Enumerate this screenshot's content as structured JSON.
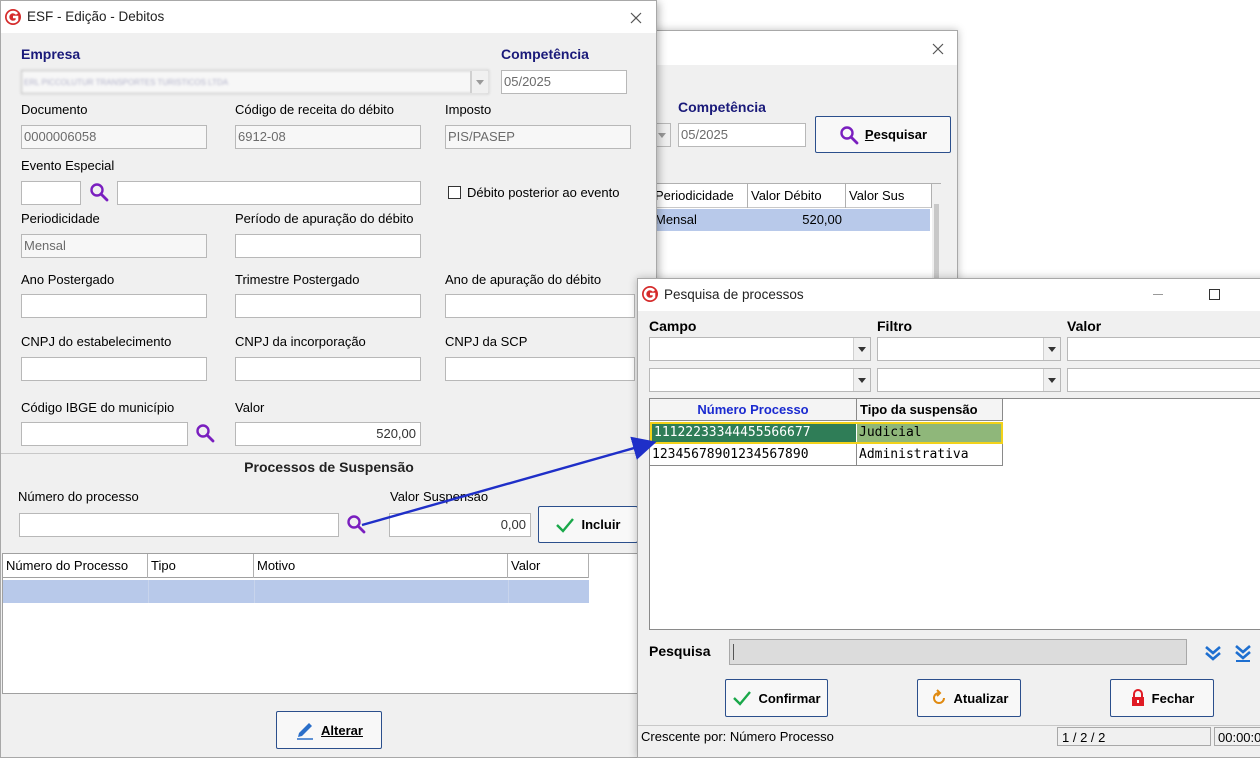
{
  "bg_window": {
    "competencia_label": "Competência",
    "competencia_value": "05/2025",
    "search_button": "Pesquisar",
    "grid_headers": [
      "Periodicidade",
      "Valor Débito",
      "Valor Sus"
    ],
    "grid_row": {
      "periodicidade": "Mensal",
      "valor": "520,00"
    }
  },
  "main_window": {
    "title": "ESF - Edição - Debitos",
    "empresa_label": "Empresa",
    "empresa_value": "ERL PICCOLUTUR TRANSPORTES TURISTICOS LTDA",
    "competencia_label": "Competência",
    "competencia_value": "05/2025",
    "documento_label": "Documento",
    "documento_value": "0000006058",
    "codigo_receita_label": "Código de receita do débito",
    "codigo_receita_value": "6912-08",
    "imposto_label": "Imposto",
    "imposto_value": "PIS/PASEP",
    "evento_especial_label": "Evento Especial",
    "debito_posterior_label": "Débito posterior ao evento",
    "periodicidade_label": "Periodicidade",
    "periodicidade_value": "Mensal",
    "periodo_apuracao_label": "Período de apuração do débito",
    "ano_postergado_label": "Ano Postergado",
    "trimestre_postergado_label": "Trimestre Postergado",
    "ano_apuracao_label": "Ano de apuração do débito",
    "cnpj_estab_label": "CNPJ do estabelecimento",
    "cnpj_incorp_label": "CNPJ da incorporação",
    "cnpj_scp_label": "CNPJ da SCP",
    "ibge_label": "Código IBGE do município",
    "valor_label": "Valor",
    "valor_value": "520,00",
    "processos_header": "Processos de Suspensão",
    "numero_processo_label": "Número do processo",
    "valor_suspensao_label": "Valor Suspensão",
    "valor_suspensao_value": "0,00",
    "incluir_button": "Incluir",
    "grid_headers": [
      "Número do Processo",
      "Tipo",
      "Motivo",
      "Valor"
    ],
    "alterar_button": "Alterar"
  },
  "search_dialog": {
    "title": "Pesquisa de processos",
    "campo_label": "Campo",
    "filtro_label": "Filtro",
    "valor_label": "Valor",
    "grid_headers": [
      "Número Processo",
      "Tipo da suspensão"
    ],
    "rows": [
      {
        "numero": "11122233344455566677",
        "tipo": "Judicial"
      },
      {
        "numero": "12345678901234567890",
        "tipo": "Administrativa"
      }
    ],
    "pesquisa_label": "Pesquisa",
    "confirmar_button": "Confirmar",
    "atualizar_button": "Atualizar",
    "fechar_button": "Fechar",
    "status_sort": "Crescente por: Número Processo",
    "status_pages": "1 / 2 / 2",
    "status_time": "00:00:0"
  },
  "colors": {
    "label_blue": "#1a1a7a",
    "magnifier": "#7a1fbf",
    "selected_row": "#b8c9ea",
    "highlight_row": "#4f8a5f",
    "arrow": "#1f2fc8",
    "lock_red": "#e01b24",
    "check_green": "#1aa84a"
  }
}
